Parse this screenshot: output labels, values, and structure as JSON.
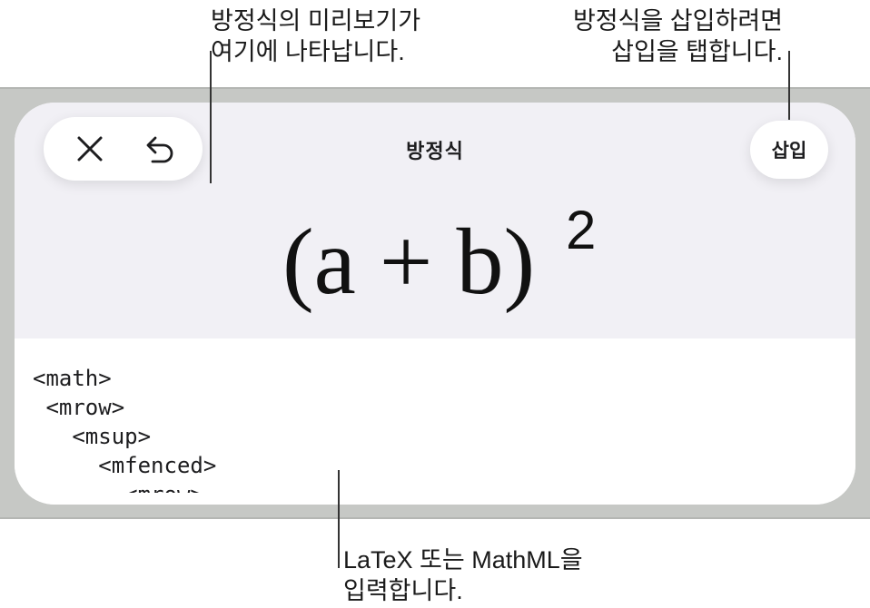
{
  "callouts": {
    "preview_line1": "방정식의 미리보기가",
    "preview_line2": "여기에 나타납니다.",
    "insert_line1": "방정식을 삽입하려면",
    "insert_line2": "삽입을 탭합니다.",
    "input_line1": "LaTeX 또는 MathML을",
    "input_line2": "입력합니다."
  },
  "toolbar": {
    "close_icon": "close-icon",
    "undo_icon": "undo-icon",
    "title": "방정식",
    "insert_label": "삽입"
  },
  "preview": {
    "formula": "(a + b)",
    "exponent": "2"
  },
  "editor": {
    "lines": [
      "<math>",
      " <mrow>",
      "   <msup>",
      "     <mfenced>",
      "       <mrow>"
    ]
  },
  "colors": {
    "frame": "#c6c8c5",
    "preview_bg": "#f1f0f5",
    "sheet_bg": "#ffffff"
  }
}
